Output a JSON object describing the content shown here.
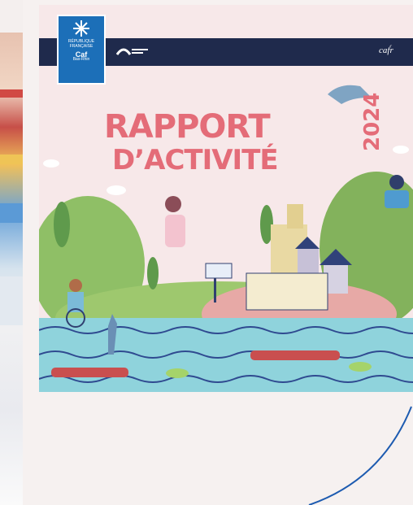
{
  "cover": {
    "title_line1": "RAPPORT",
    "title_line2": "D’ACTIVITÉ",
    "year": "2024",
    "header_right_logo": "caf́r",
    "badge": {
      "brand": "Caf",
      "lines": [
        "RÉPUBLIQUE",
        "FRANÇAISE",
        "Bas-Rhin"
      ]
    }
  },
  "colors": {
    "title_pink": "#e46c78",
    "header_navy": "#1f2a4c",
    "badge_blue": "#1c6fb8",
    "arc_blue": "#1d5bb0"
  },
  "icons": [
    "caf-badge-icon",
    "cnaf-arc-logo-icon",
    "heron-icon"
  ]
}
